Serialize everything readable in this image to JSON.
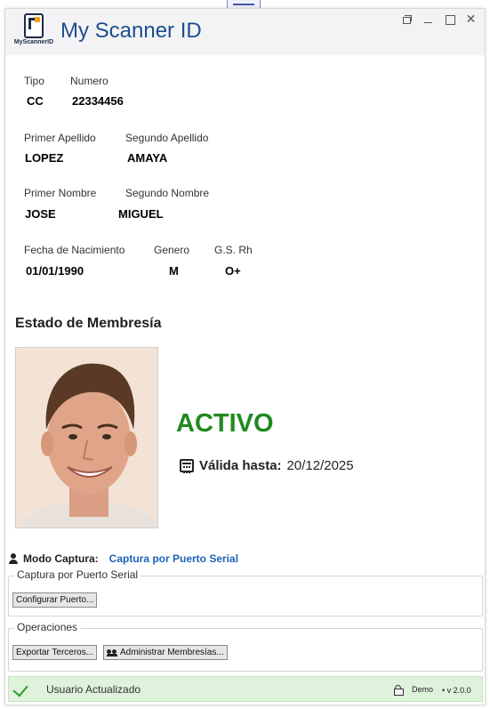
{
  "window": {
    "title": "My Scanner ID",
    "logo_text": "MyScannerID"
  },
  "titlebar_icons": {
    "restore": "restore-icon",
    "minimize": "minimize-icon",
    "maximize": "maximize-icon",
    "close": "close-icon",
    "close_glyph": "✕"
  },
  "form": {
    "tipo_label": "Tipo",
    "tipo_value": "CC",
    "numero_label": "Numero",
    "numero_value": "22334456",
    "primer_apellido_label": "Primer Apellido",
    "primer_apellido_value": "LOPEZ",
    "segundo_apellido_label": "Segundo Apellido",
    "segundo_apellido_value": "AMAYA",
    "primer_nombre_label": "Primer Nombre",
    "primer_nombre_value": "JOSE",
    "segundo_nombre_label": "Segundo Nombre",
    "segundo_nombre_value": "MIGUEL",
    "fecha_label": "Fecha de Nacimiento",
    "fecha_value": "01/01/1990",
    "genero_label": "Genero",
    "genero_value": "M",
    "gs_label": "G.S. Rh",
    "gs_value": "O+"
  },
  "membership": {
    "section_title": "Estado de Membresía",
    "status": "ACTIVO",
    "valid_label": "Válida hasta:",
    "valid_date": "20/12/2025",
    "status_color": "#1f8a1f"
  },
  "capture": {
    "mode_label": "Modo Captura:",
    "mode_value": "Captura por Puerto Serial",
    "group_title": "Captura por Puerto Serial",
    "configure_button": "Configurar Puerto..."
  },
  "operations": {
    "group_title": "Operaciones",
    "export_button": "Exportar Terceros...",
    "manage_button": "Administrar Membresías..."
  },
  "statusbar": {
    "message": "Usuario Actualizado",
    "mode": "Demo",
    "version": "• v 2.0.0"
  },
  "colors": {
    "title_blue": "#1e4d8f",
    "link_blue": "#1e63b8",
    "status_green_bg": "#dff2dc"
  }
}
